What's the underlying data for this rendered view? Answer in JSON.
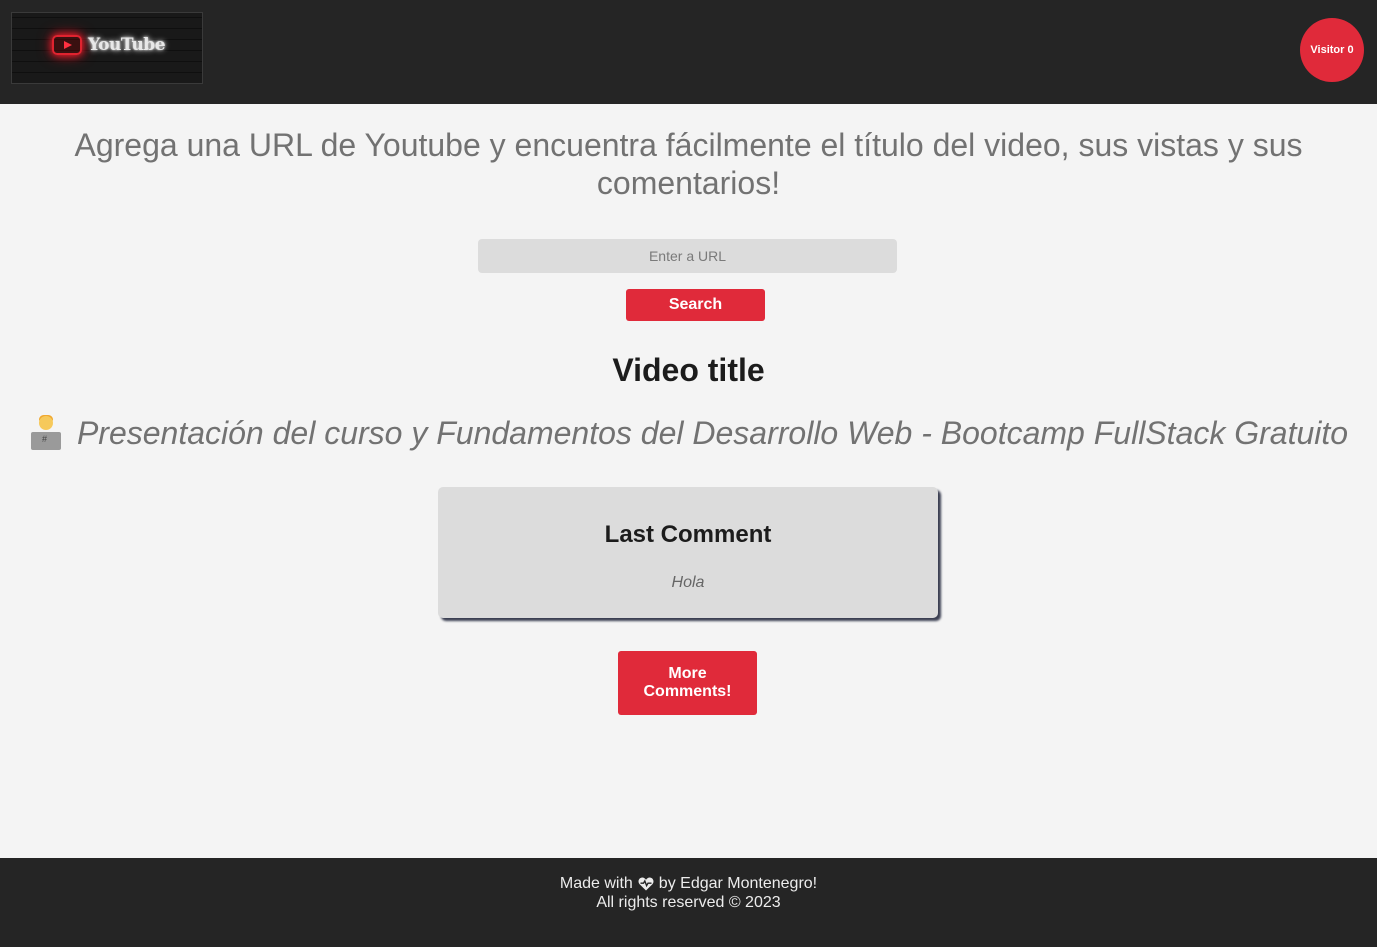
{
  "header": {
    "logo_text": "YouTube",
    "visitor_label": "Visitor 0"
  },
  "main": {
    "headline": "Agrega una URL de Youtube y encuentra fácilmente el título del video, sus vistas y sus comentarios!",
    "url_input": {
      "placeholder": "Enter a URL",
      "value": ""
    },
    "search_label": "Search",
    "video_title_heading": "Video title",
    "video_title_icon": "technologist-icon",
    "video_title": "Presentación del curso y Fundamentos del Desarrollo Web - Bootcamp FullStack Gratuito",
    "last_comment_heading": "Last Comment",
    "last_comment_text": "Hola",
    "more_comments_label": "More Comments!"
  },
  "footer": {
    "made_with_prefix": "Made with",
    "heart_icon": "heart-pulse-icon",
    "made_with_suffix": "by Edgar Montenegro!",
    "rights": "All rights reserved © 2023"
  },
  "colors": {
    "accent_red": "#e02a3a",
    "header_bg": "#252525",
    "page_bg": "#f4f4f4"
  }
}
